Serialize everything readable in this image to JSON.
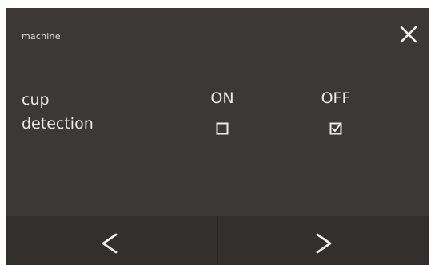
{
  "header": {
    "title": "machine",
    "close_icon": "close-icon"
  },
  "setting": {
    "label_line1": "cup",
    "label_line2": "detection",
    "options": [
      {
        "label": "ON",
        "checked": false
      },
      {
        "label": "OFF",
        "checked": true
      }
    ]
  },
  "navigation": {
    "prev_icon": "chevron-left-icon",
    "next_icon": "chevron-right-icon"
  },
  "colors": {
    "panel_background": "#3b3835",
    "nav_background": "#332f2c",
    "text": "#eeeae6"
  }
}
